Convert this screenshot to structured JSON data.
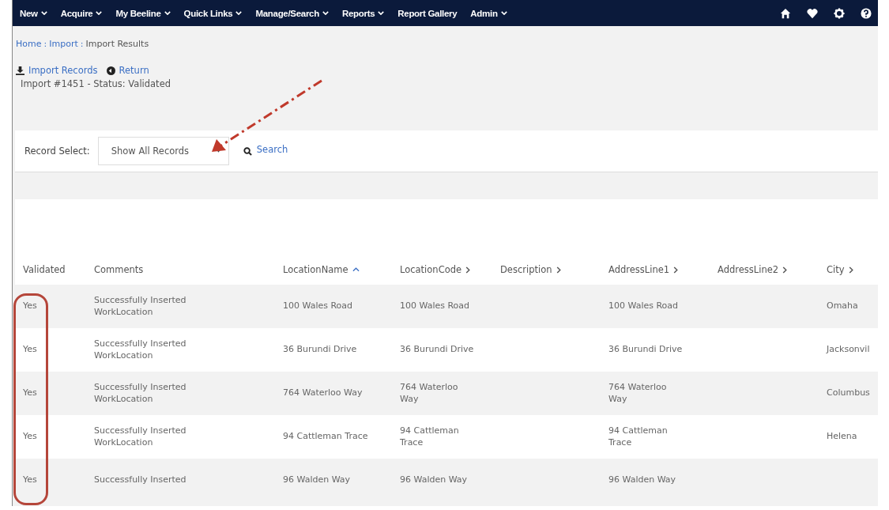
{
  "nav": {
    "items": [
      {
        "label": "New",
        "dropdown": true
      },
      {
        "label": "Acquire",
        "dropdown": true
      },
      {
        "label": "My Beeline",
        "dropdown": true
      },
      {
        "label": "Quick Links",
        "dropdown": true
      },
      {
        "label": "Manage/Search",
        "dropdown": true
      },
      {
        "label": "Reports",
        "dropdown": true
      },
      {
        "label": "Report Gallery",
        "dropdown": false
      },
      {
        "label": "Admin",
        "dropdown": true
      }
    ]
  },
  "breadcrumb": {
    "separator": ":",
    "items": [
      {
        "label": "Home",
        "link": true
      },
      {
        "label": "Import",
        "link": true
      },
      {
        "label": "Import Results",
        "link": false
      }
    ]
  },
  "actions": [
    {
      "label": "Import Records",
      "kind": "download"
    },
    {
      "label": "Return",
      "kind": "return"
    }
  ],
  "status_text": "Import #1451 - Status: Validated",
  "filter": {
    "label": "Record Select:",
    "value": "Show All Records",
    "search": "Search"
  },
  "table": {
    "columns": [
      {
        "label": "Validated",
        "kind": "plain"
      },
      {
        "label": "Comments",
        "kind": "plain"
      },
      {
        "label": "LocationName",
        "kind": "sorted"
      },
      {
        "label": "LocationCode",
        "kind": "sortable"
      },
      {
        "label": "Description",
        "kind": "sortable"
      },
      {
        "label": "AddressLine1",
        "kind": "sortable"
      },
      {
        "label": "AddressLine2",
        "kind": "sortable"
      },
      {
        "label": "City",
        "kind": "sortable"
      }
    ],
    "rows": [
      [
        "Yes",
        "Successfully Inserted WorkLocation",
        "100 Wales Road",
        "100 Wales Road",
        "",
        "100 Wales Road",
        "",
        "Omaha"
      ],
      [
        "Yes",
        "Successfully Inserted WorkLocation",
        "36 Burundi Drive",
        "36 Burundi Drive",
        "",
        "36 Burundi Drive",
        "",
        "Jacksonvil"
      ],
      [
        "Yes",
        "Successfully Inserted WorkLocation",
        "764 Waterloo Way",
        "764 Waterloo Way",
        "",
        "764 Waterloo Way",
        "",
        "Columbus"
      ],
      [
        "Yes",
        "Successfully Inserted WorkLocation",
        "94 Cattleman Trace",
        "94 Cattleman Trace",
        "",
        "94 Cattleman Trace",
        "",
        "Helena"
      ],
      [
        "Yes",
        "Successfully Inserted",
        "96 Walden Way",
        "96 Walden Way",
        "",
        "96 Walden Way",
        "",
        ""
      ]
    ]
  }
}
